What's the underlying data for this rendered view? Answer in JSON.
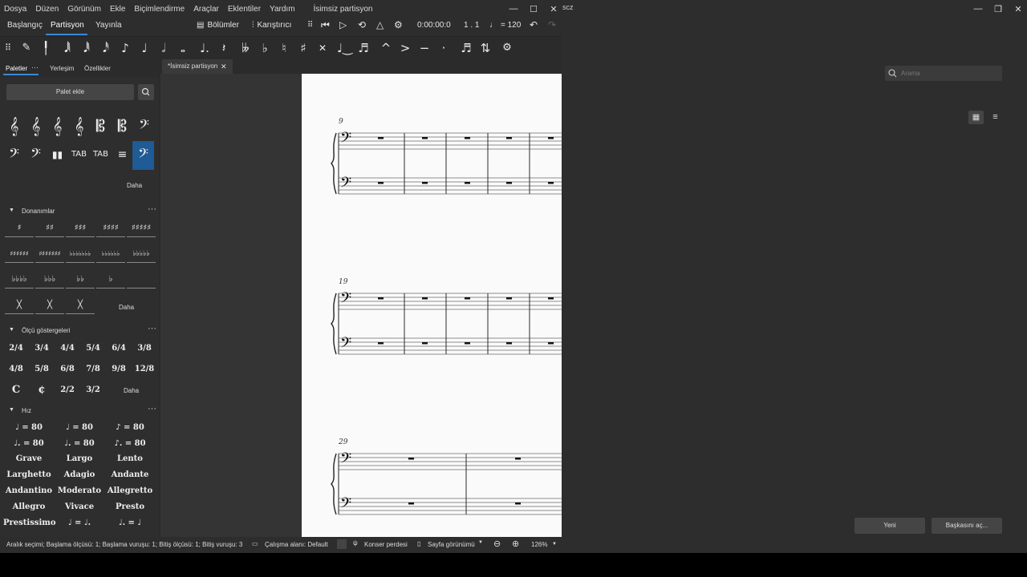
{
  "menu": [
    "Dosya",
    "Düzen",
    "Görünüm",
    "Ekle",
    "Biçimlendirme",
    "Araçlar",
    "Eklentiler",
    "Yardım"
  ],
  "window_title": "İsimsiz partisyon",
  "right_title_fragment": "scz",
  "tabs": [
    "Başlangıç",
    "Partisyon",
    "Yayınla"
  ],
  "toolbar": {
    "parts": "Bölümler",
    "mixer": "Karıştırıcı",
    "time": "0:00:00:0",
    "position": "1 . 1",
    "tempo": "= 120"
  },
  "left_tabs": [
    "Paletler",
    "Yerleşim",
    "Özellikler"
  ],
  "add_palette": "Palet ekle",
  "clefs_more": "Daha",
  "sections": {
    "keys": "Donanımlar",
    "time": "Ölçü göstergeleri",
    "tempo": "Hız"
  },
  "keys_more": "Daha",
  "time_more": "Daha",
  "time_sigs": [
    "2/4",
    "3/4",
    "4/4",
    "5/4",
    "6/4",
    "3/8",
    "4/8",
    "5/8",
    "6/8",
    "7/8",
    "9/8",
    "12/8",
    "C",
    "¢",
    "2/2",
    "3/2"
  ],
  "tempo_marks": [
    "♩ = 80",
    "♩ = 80",
    "♪ = 80",
    "♩. = 80",
    "♩. = 80",
    "♪. = 80"
  ],
  "tempo_words": [
    "Grave",
    "Largo",
    "Lento",
    "Larghetto",
    "Adagio",
    "Andante",
    "Andantino",
    "Moderato",
    "Allegretto",
    "Allegro",
    "Vivace",
    "Presto",
    "Prestissimo",
    "♩ = ♩.",
    "♩. = ♩"
  ],
  "doc_tab": "*İsimsiz partisyon",
  "measure_numbers": [
    "9",
    "19",
    "29"
  ],
  "search_placeholder": "Arama",
  "buttons": {
    "new": "Yeni",
    "open_other": "Başkasını aç..."
  },
  "status": {
    "selection": "Aralık seçimi; Başlama ölçüsü: 1; Başlama vuruşu: 1; Bitiş ölçüsü: 1; Bitiş vuruşu: 3",
    "workspace": "Çalışma alanı: Default",
    "concert": "Konser perdesi",
    "page_view": "Sayfa görünümü",
    "zoom": "126%"
  },
  "colors": {
    "accent": "#3b86d6",
    "selected_cell": "#1f5b94",
    "page": "#fafafa"
  }
}
